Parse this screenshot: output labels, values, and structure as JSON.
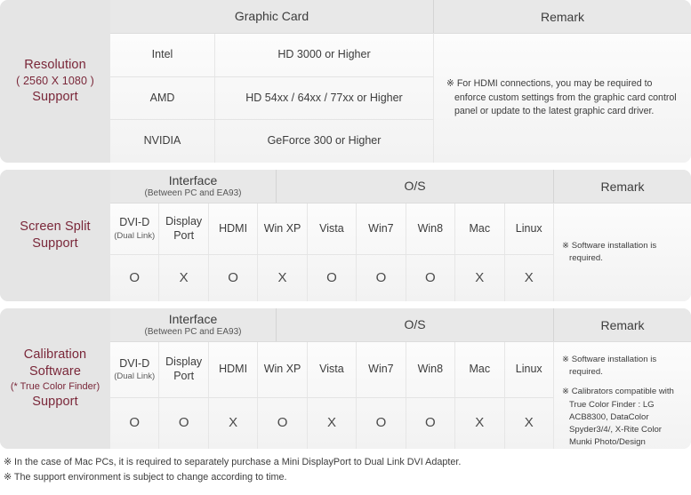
{
  "tables": [
    {
      "id": "resolution-support",
      "label": {
        "line1": "Resolution",
        "line2": "( 2560 X 1080 )",
        "line3": "Support"
      },
      "groups": [
        {
          "title": "Graphic Card",
          "sub": ""
        },
        {
          "title": "Remark",
          "sub": ""
        }
      ],
      "rows": [
        {
          "vendor": "Intel",
          "spec": "HD 3000 or Higher"
        },
        {
          "vendor": "AMD",
          "spec": "HD 54xx / 64xx / 77xx or Higher"
        },
        {
          "vendor": "NVIDIA",
          "spec": "GeForce 300 or Higher"
        }
      ],
      "remark_notes": [
        "※ For HDMI connections, you may be required to enforce custom settings from the graphic card control panel or update to the latest graphic card driver."
      ]
    },
    {
      "id": "screen-split-support",
      "label": {
        "line1": "Screen Split",
        "line2": "",
        "line3": "Support"
      },
      "label_lines": [
        "Screen Split",
        "Support"
      ],
      "groups": [
        {
          "title": "Interface",
          "sub": "(Between PC and EA93)"
        },
        {
          "title": "O/S",
          "sub": ""
        },
        {
          "title": "Remark",
          "sub": ""
        }
      ],
      "columns": [
        {
          "name": "DVI-D",
          "sub": "(Dual Link)"
        },
        {
          "name": "Display",
          "sub": "Port"
        },
        {
          "name": "HDMI",
          "sub": ""
        },
        {
          "name": "Win XP",
          "sub": ""
        },
        {
          "name": "Vista",
          "sub": ""
        },
        {
          "name": "Win7",
          "sub": ""
        },
        {
          "name": "Win8",
          "sub": ""
        },
        {
          "name": "Mac",
          "sub": ""
        },
        {
          "name": "Linux",
          "sub": ""
        }
      ],
      "values": [
        "O",
        "X",
        "O",
        "X",
        "O",
        "O",
        "O",
        "X",
        "X"
      ],
      "remark_notes": [
        "※ Software installation is required."
      ]
    },
    {
      "id": "calibration-software-support",
      "label": {
        "line1": "Calibration",
        "line2": "Software",
        "line3": "( * True Color Finder )",
        "line4": "Support"
      },
      "label_lines": [
        "Calibration",
        "Software",
        "(* True Color Finder)",
        "Support"
      ],
      "groups": [
        {
          "title": "Interface",
          "sub": "(Between PC and EA93)"
        },
        {
          "title": "O/S",
          "sub": ""
        },
        {
          "title": "Remark",
          "sub": ""
        }
      ],
      "columns": [
        {
          "name": "DVI-D",
          "sub": "(Dual Link)"
        },
        {
          "name": "Display",
          "sub": "Port"
        },
        {
          "name": "HDMI",
          "sub": ""
        },
        {
          "name": "Win XP",
          "sub": ""
        },
        {
          "name": "Vista",
          "sub": ""
        },
        {
          "name": "Win7",
          "sub": ""
        },
        {
          "name": "Win8",
          "sub": ""
        },
        {
          "name": "Mac",
          "sub": ""
        },
        {
          "name": "Linux",
          "sub": ""
        }
      ],
      "values": [
        "O",
        "O",
        "X",
        "O",
        "X",
        "O",
        "O",
        "X",
        "X"
      ],
      "remark_notes": [
        "※ Software installation is required.",
        "※ Calibrators compatible with True Color Finder : LG ACB8300, DataColor Spyder3/4/, X-Rite Color Munki Photo/Design"
      ]
    }
  ],
  "footnotes": [
    "※ In the case of Mac PCs, it is required to separately purchase a Mini DisplayPort to Dual Link DVI Adapter.",
    "※ The support environment is subject to change according to time."
  ],
  "colors": {
    "label_text": "#7a2739",
    "card_bg": "#e8e8e8",
    "body_bg": "#fafafa",
    "text": "#3c3c3c"
  }
}
